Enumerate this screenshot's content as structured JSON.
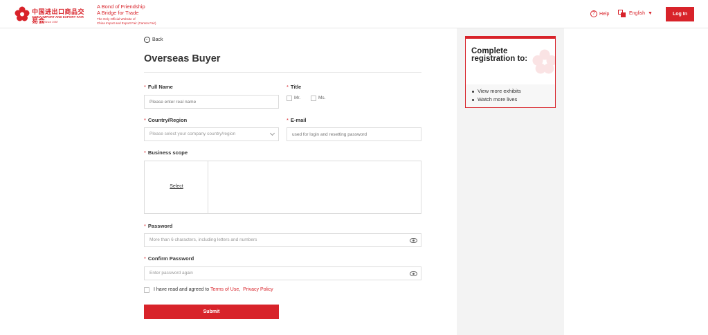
{
  "header": {
    "logo_cn": "中国进出口商品交易会",
    "logo_en": "CHINA IMPORT AND EXPORT FAIR",
    "logo_since": "Since 1957",
    "slogan_line1": "A Bond of Friendship",
    "slogan_line2": "A Bridge for Trade",
    "slogan_line3": "The Only Official Website of",
    "slogan_line4": "China Import and Export Fair (Canton Fair)",
    "help_label": "Help",
    "language_label": "English",
    "login_label": "Log In"
  },
  "form": {
    "back_label": "Back",
    "title": "Overseas Buyer",
    "full_name": {
      "label": "Full Name",
      "placeholder": "Please enter real name"
    },
    "title_field": {
      "label": "Title",
      "options": [
        "Mr.",
        "Ms."
      ]
    },
    "country": {
      "label": "Country/Region",
      "placeholder": "Please select your company country/region"
    },
    "email": {
      "label": "E-mail",
      "placeholder": "used for login and resetting password"
    },
    "business_scope": {
      "label": "Business scope",
      "select_label": "Select"
    },
    "password": {
      "label": "Password",
      "placeholder": "More than 6 characters, including letters and numbers"
    },
    "confirm_password": {
      "label": "Confirm Password",
      "placeholder": "Enter password again"
    },
    "agreement": {
      "prefix": "I have read and agreed to ",
      "terms": "Terms of Use",
      "separator": ",",
      "privacy": "Privacy Policy"
    },
    "submit_label": "Submit"
  },
  "promo": {
    "title": "Complete registration to:",
    "items": [
      "View more exhibits",
      "Watch more lives"
    ]
  },
  "colors": {
    "brand_red": "#d8232a",
    "side_grey": "#f3f3f3"
  }
}
